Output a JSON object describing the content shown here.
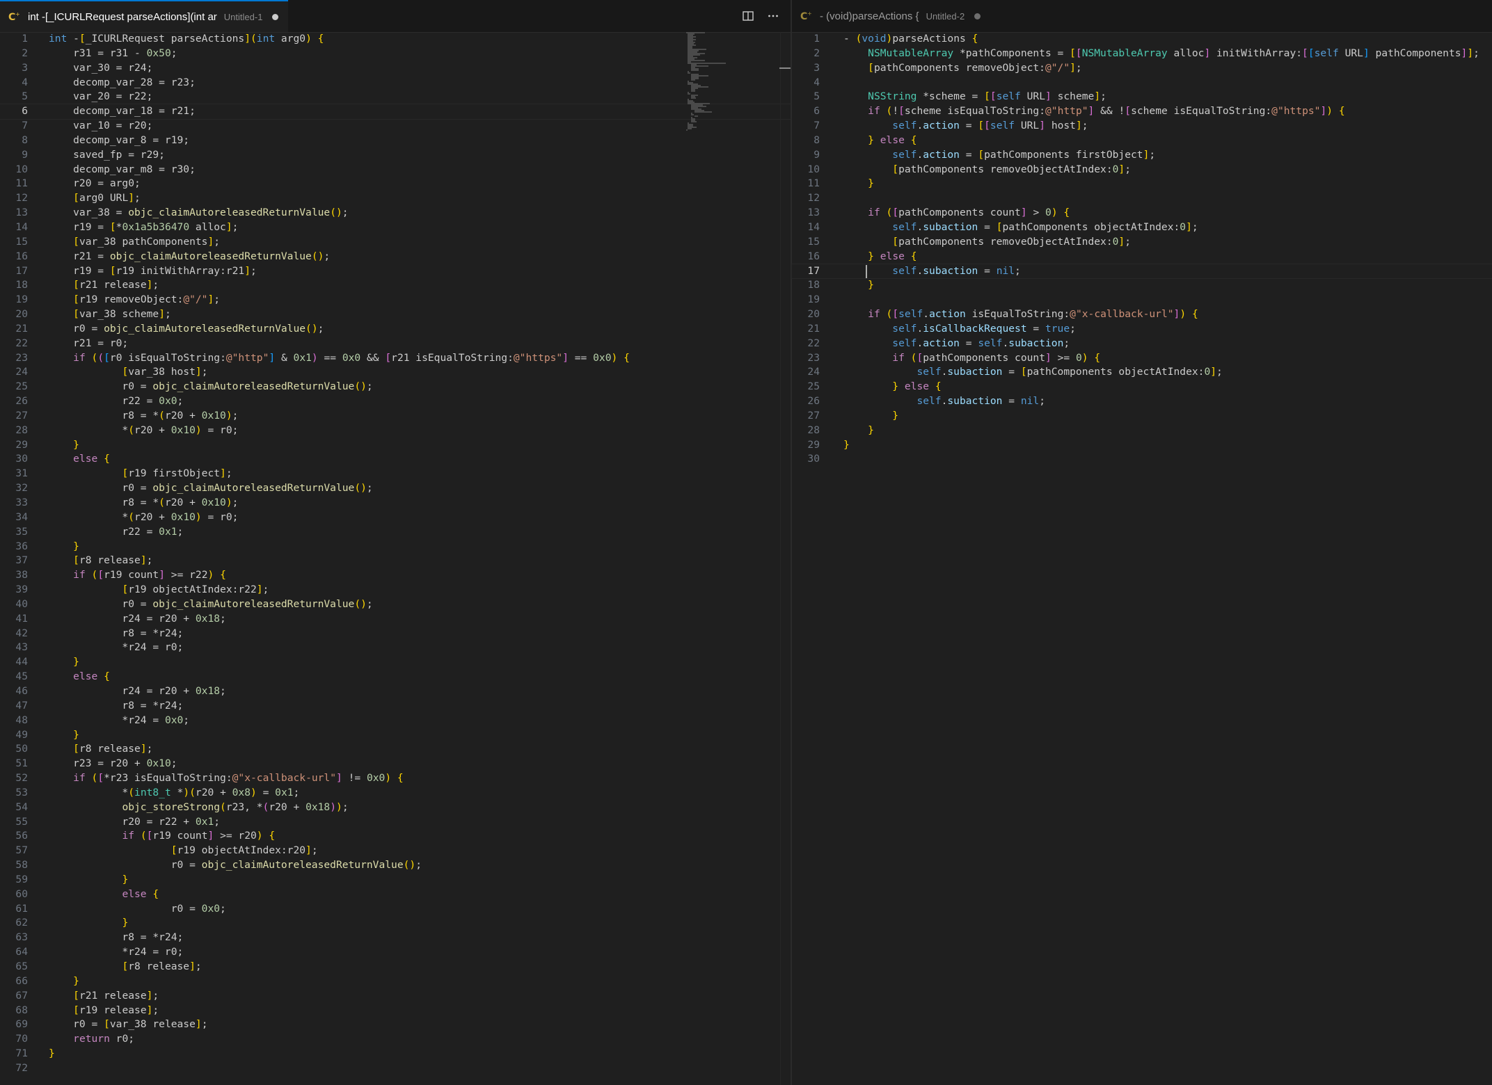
{
  "left_editor": {
    "tab": {
      "title": "int -[_ICURLRequest parseActions](int ar",
      "description": "Untitled-1",
      "unsaved": true,
      "icon": "objc-file-icon"
    },
    "actions": [
      {
        "name": "split-editor-icon"
      },
      {
        "name": "more-actions-icon"
      }
    ],
    "active_line": 6,
    "lines": [
      "int -[_ICURLRequest parseActions](int arg0) {",
      "    r31 = r31 - 0x50;",
      "    var_30 = r24;",
      "    decomp_var_28 = r23;",
      "    var_20 = r22;",
      "    decomp_var_18 = r21;",
      "    var_10 = r20;",
      "    decomp_var_8 = r19;",
      "    saved_fp = r29;",
      "    decomp_var_m8 = r30;",
      "    r20 = arg0;",
      "    [arg0 URL];",
      "    var_38 = objc_claimAutoreleasedReturnValue();",
      "    r19 = [*0x1a5b36470 alloc];",
      "    [var_38 pathComponents];",
      "    r21 = objc_claimAutoreleasedReturnValue();",
      "    r19 = [r19 initWithArray:r21];",
      "    [r21 release];",
      "    [r19 removeObject:@\"/\"];",
      "    [var_38 scheme];",
      "    r0 = objc_claimAutoreleasedReturnValue();",
      "    r21 = r0;",
      "    if (([r0 isEqualToString:@\"http\"] & 0x1) == 0x0 && [r21 isEqualToString:@\"https\"] == 0x0) {",
      "            [var_38 host];",
      "            r0 = objc_claimAutoreleasedReturnValue();",
      "            r22 = 0x0;",
      "            r8 = *(r20 + 0x10);",
      "            *(r20 + 0x10) = r0;",
      "    }",
      "    else {",
      "            [r19 firstObject];",
      "            r0 = objc_claimAutoreleasedReturnValue();",
      "            r8 = *(r20 + 0x10);",
      "            *(r20 + 0x10) = r0;",
      "            r22 = 0x1;",
      "    }",
      "    [r8 release];",
      "    if ([r19 count] >= r22) {",
      "            [r19 objectAtIndex:r22];",
      "            r0 = objc_claimAutoreleasedReturnValue();",
      "            r24 = r20 + 0x18;",
      "            r8 = *r24;",
      "            *r24 = r0;",
      "    }",
      "    else {",
      "            r24 = r20 + 0x18;",
      "            r8 = *r24;",
      "            *r24 = 0x0;",
      "    }",
      "    [r8 release];",
      "    r23 = r20 + 0x10;",
      "    if ([*r23 isEqualToString:@\"x-callback-url\"] != 0x0) {",
      "            *(int8_t *)(r20 + 0x8) = 0x1;",
      "            objc_storeStrong(r23, *(r20 + 0x18));",
      "            r20 = r22 + 0x1;",
      "            if ([r19 count] >= r20) {",
      "                    [r19 objectAtIndex:r20];",
      "                    r0 = objc_claimAutoreleasedReturnValue();",
      "            }",
      "            else {",
      "                    r0 = 0x0;",
      "            }",
      "            r8 = *r24;",
      "            *r24 = r0;",
      "            [r8 release];",
      "    }",
      "    [r21 release];",
      "    [r19 release];",
      "    r0 = [var_38 release];",
      "    return r0;",
      "}",
      ""
    ]
  },
  "right_editor": {
    "tab": {
      "title": "- (void)parseActions {",
      "description": "Untitled-2",
      "unsaved": true,
      "icon": "objc-file-icon"
    },
    "active_line": 17,
    "lines": [
      "- (void)parseActions {",
      "    NSMutableArray *pathComponents = [[NSMutableArray alloc] initWithArray:[[self URL] pathComponents]];",
      "    [pathComponents removeObject:@\"/\"];",
      "",
      "    NSString *scheme = [[self URL] scheme];",
      "    if (![scheme isEqualToString:@\"http\"] && ![scheme isEqualToString:@\"https\"]) {",
      "        self.action = [[self URL] host];",
      "    } else {",
      "        self.action = [pathComponents firstObject];",
      "        [pathComponents removeObjectAtIndex:0];",
      "    }",
      "",
      "    if ([pathComponents count] > 0) {",
      "        self.subaction = [pathComponents objectAtIndex:0];",
      "        [pathComponents removeObjectAtIndex:0];",
      "    } else {",
      "        self.subaction = nil;",
      "    }",
      "",
      "    if ([self.action isEqualToString:@\"x-callback-url\"]) {",
      "        self.isCallbackRequest = true;",
      "        self.action = self.subaction;",
      "        if ([pathComponents count] >= 0) {",
      "            self.subaction = [pathComponents objectAtIndex:0];",
      "        } else {",
      "            self.subaction = nil;",
      "        }",
      "    }",
      "}",
      ""
    ]
  }
}
